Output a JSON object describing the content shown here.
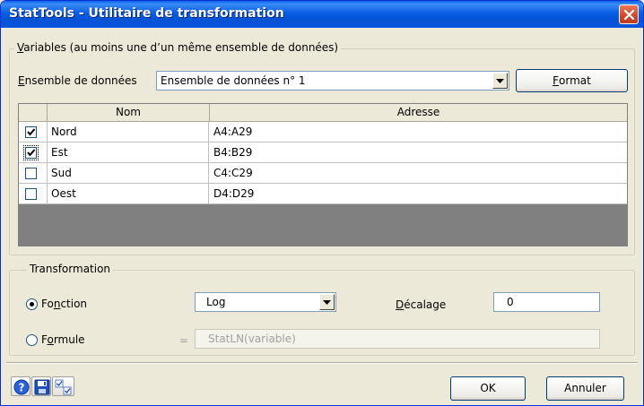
{
  "window": {
    "title": "StatTools - Utilitaire de transformation"
  },
  "variables": {
    "legend": "Variables (au moins une d'un même ensemble de données)",
    "legend_first": "V",
    "legend_rest": "ariables (au moins une d’un même ensemble de données)",
    "dataset_label_first": "E",
    "dataset_label_rest": "nsemble de données",
    "dataset_value": "Ensemble de données n° 1",
    "format_first": "F",
    "format_rest": "ormat",
    "columns": {
      "name": "Nom",
      "address": "Adresse"
    },
    "rows": [
      {
        "checked": true,
        "name": "Nord",
        "address": "A4:A29"
      },
      {
        "checked": true,
        "name": "Est",
        "address": "B4:B29"
      },
      {
        "checked": false,
        "name": "Sud",
        "address": "C4:C29"
      },
      {
        "checked": false,
        "name": "Oest",
        "address": "D4:D29"
      }
    ]
  },
  "transformation": {
    "legend": "Transformation",
    "function_pre": "Fo",
    "function_u": "n",
    "function_post": "ction",
    "function_selected": true,
    "function_value": "Log",
    "offset_first": "D",
    "offset_rest": "écalage",
    "offset_value": "0",
    "formula_pre": "F",
    "formula_u": "o",
    "formula_post": "rmule",
    "formula_selected": false,
    "equals": "=",
    "formula_value": "StatLN(variable)"
  },
  "buttons": {
    "ok": "OK",
    "cancel": "Annuler"
  },
  "icons": {
    "help": "help-icon",
    "save": "save-icon",
    "options": "checkbox-settings-icon",
    "close": "close-icon",
    "dropdown": "chevron-down-icon"
  },
  "colors": {
    "titlebar": "#0553d4",
    "close": "#d2452a",
    "grid_background": "#808080"
  }
}
